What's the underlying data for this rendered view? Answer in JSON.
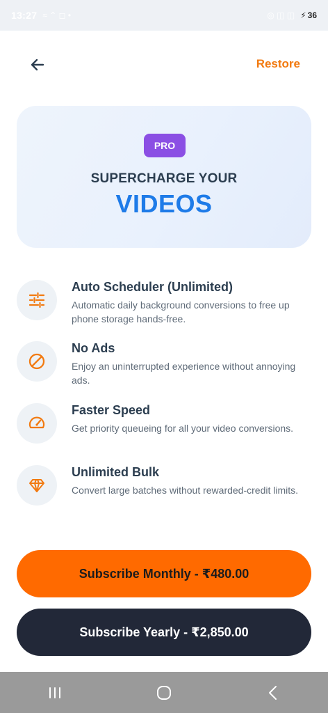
{
  "status_bar": {
    "time": "13:27",
    "left_icons": "≈ ⌃ ◻ •",
    "right_icons": "◎ ◫ ◫",
    "battery": "36"
  },
  "header": {
    "restore_label": "Restore"
  },
  "hero": {
    "badge": "PRO",
    "subtitle": "SUPERCHARGE YOUR",
    "title": "VIDEOS"
  },
  "features": [
    {
      "title": "Auto Scheduler (Unlimited)",
      "description": "Automatic daily background conversions to free up phone storage hands-free.",
      "icon": "sliders-icon"
    },
    {
      "title": "No Ads",
      "description": "Enjoy an uninterrupted experience without annoying ads.",
      "icon": "no-entry-icon"
    },
    {
      "title": "Faster Speed",
      "description": "Get priority queueing for all your video conversions.",
      "icon": "speedometer-icon"
    },
    {
      "title": "Unlimited Bulk",
      "description": "Convert large batches without rewarded-credit limits.",
      "icon": "diamond-icon"
    }
  ],
  "buttons": {
    "monthly": "Subscribe Monthly - ₹480.00",
    "yearly": "Subscribe Yearly - ₹2,850.00"
  },
  "colors": {
    "accent_orange": "#f27a10",
    "button_orange": "#ff6a00",
    "pro_purple": "#8b4fe4",
    "title_blue": "#1e7be8",
    "dark_button": "#222838"
  }
}
